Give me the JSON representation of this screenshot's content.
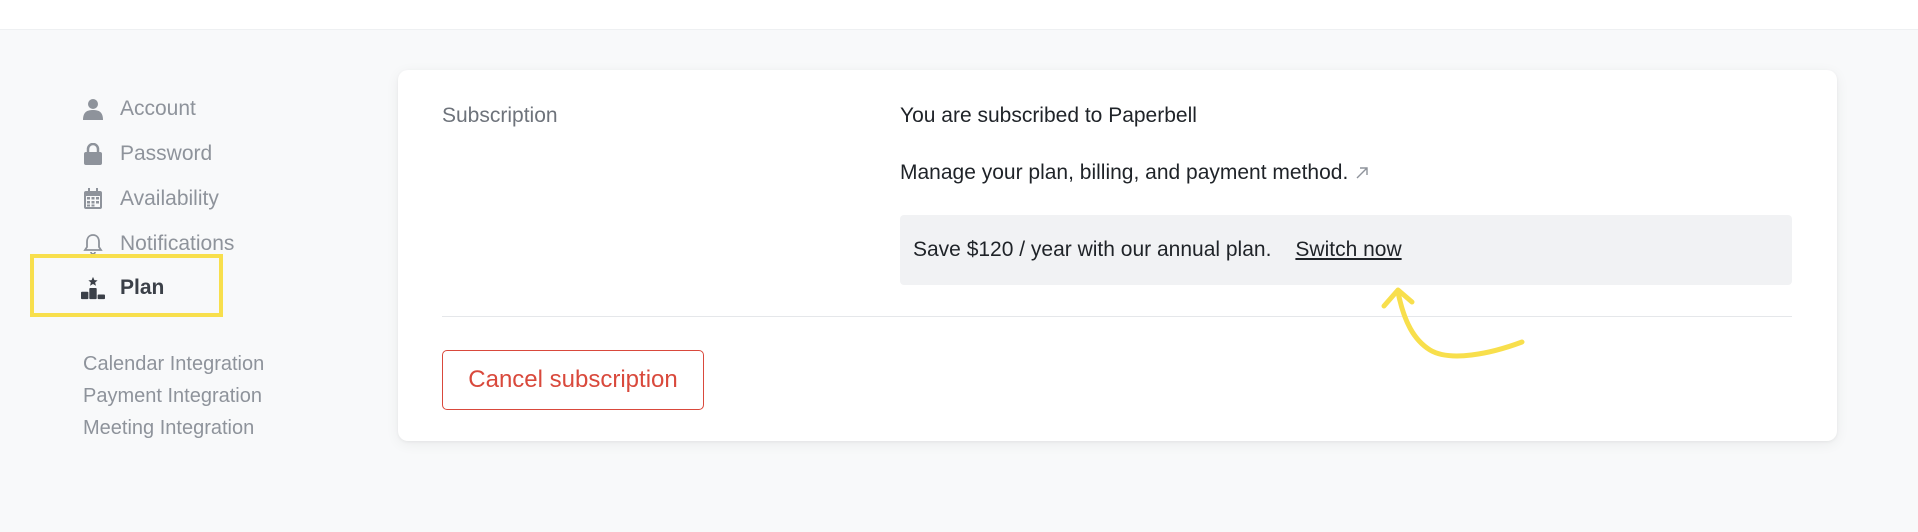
{
  "sidebar": {
    "items": [
      {
        "label": "Account",
        "icon": "user-icon"
      },
      {
        "label": "Password",
        "icon": "lock-icon"
      },
      {
        "label": "Availability",
        "icon": "calendar-icon"
      },
      {
        "label": "Notifications",
        "icon": "bell-icon"
      },
      {
        "label": "Plan",
        "icon": "podium-icon",
        "active": true
      }
    ],
    "integrations": [
      "Calendar Integration",
      "Payment Integration",
      "Meeting Integration"
    ]
  },
  "subscription": {
    "section_label": "Subscription",
    "status_text": "You are subscribed to Paperbell",
    "manage_text": "Manage your plan, billing, and payment method.",
    "manage_icon": "external-link-icon",
    "promo_text": "Save $120 / year with our annual plan.",
    "promo_link": "Switch now",
    "cancel_label": "Cancel subscription"
  },
  "colors": {
    "page_background": "#f8f9fa",
    "highlight": "#f8df4c",
    "danger": "#d9493c",
    "muted_text": "#8e939b",
    "active_text": "#3b4048"
  }
}
